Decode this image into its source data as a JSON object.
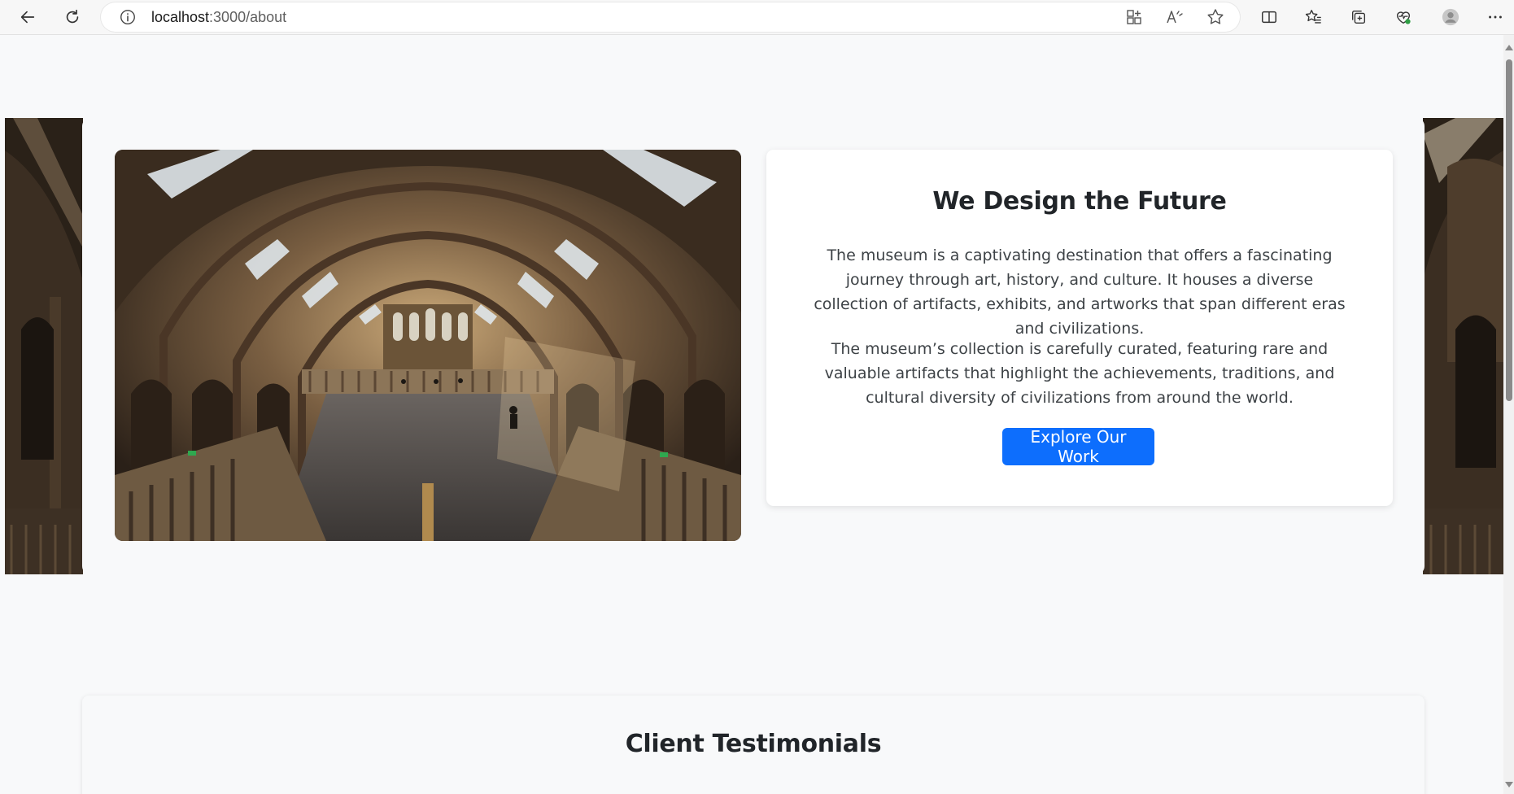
{
  "browser": {
    "url_host": "localhost",
    "url_path": ":3000/about",
    "icons": {
      "back": "back-arrow-icon",
      "refresh": "refresh-icon",
      "info": "info-icon",
      "apps": "app-available-icon",
      "read_aloud": "read-aloud-icon",
      "favorite": "star-icon",
      "split": "split-screen-icon",
      "favorites": "favorites-icon",
      "collections": "collections-icon",
      "health": "browser-essentials-icon",
      "profile": "profile-avatar-icon",
      "more": "more-menu-icon"
    }
  },
  "hero": {
    "title": "We Design the Future",
    "paragraph_1": "The museum is a captivating destination that offers a fascinating journey through art, history, and culture. It houses a diverse collection of artifacts, exhibits, and artworks that span different eras and civilizations.",
    "paragraph_2": "The museum’s collection is carefully curated, featuring rare and valuable artifacts that highlight the achievements, traditions, and cultural diversity of civilizations from around the world.",
    "button_label": "Explore Our Work",
    "button_color": "#0d6efd",
    "image": "museum-hall-photo"
  },
  "testimonials": {
    "title": "Client Testimonials"
  }
}
